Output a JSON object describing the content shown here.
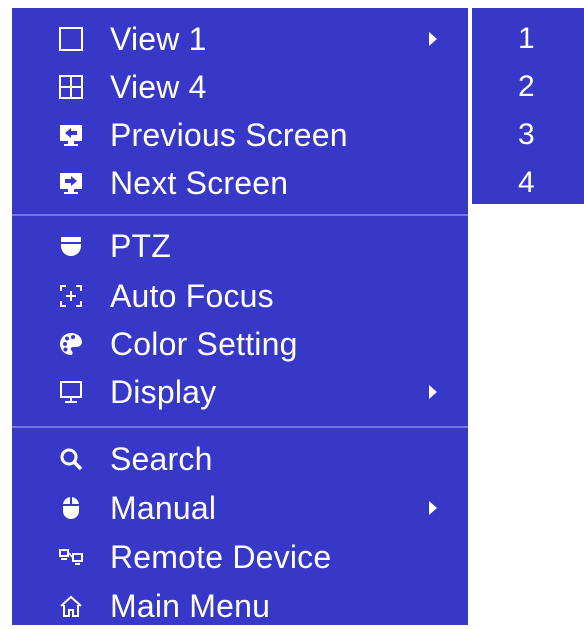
{
  "menu": {
    "items": [
      {
        "label": "View 1",
        "icon": "single-view-icon",
        "submenu": true
      },
      {
        "label": "View 4",
        "icon": "quad-view-icon",
        "submenu": false
      },
      {
        "label": "Previous Screen",
        "icon": "previous-screen-icon",
        "submenu": false
      },
      {
        "label": "Next Screen",
        "icon": "next-screen-icon",
        "submenu": false
      },
      {
        "label": "PTZ",
        "icon": "ptz-camera-icon",
        "submenu": false
      },
      {
        "label": "Auto Focus",
        "icon": "auto-focus-icon",
        "submenu": false
      },
      {
        "label": "Color Setting",
        "icon": "palette-icon",
        "submenu": false
      },
      {
        "label": "Display",
        "icon": "monitor-icon",
        "submenu": true
      },
      {
        "label": "Search",
        "icon": "search-icon",
        "submenu": false
      },
      {
        "label": "Manual",
        "icon": "mouse-icon",
        "submenu": true
      },
      {
        "label": "Remote Device",
        "icon": "remote-device-icon",
        "submenu": false
      },
      {
        "label": "Main Menu",
        "icon": "home-icon",
        "submenu": false
      }
    ]
  },
  "submenu": {
    "items": [
      "1",
      "2",
      "3",
      "4"
    ]
  },
  "colors": {
    "menu_background": "#3737c8",
    "separator": "#7575dd",
    "text": "#ffffff"
  }
}
